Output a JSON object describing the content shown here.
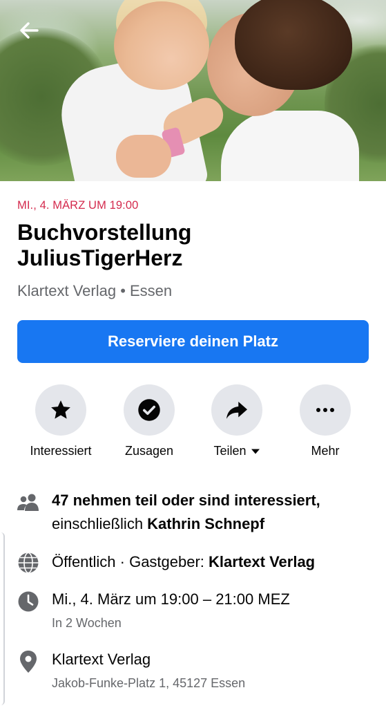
{
  "hero": {
    "image_alt": "Frau küsst Kind auf einer Wiese"
  },
  "event": {
    "date_line": "MI., 4. MÄRZ UM 19:00",
    "title_line1": "Buchvorstellung",
    "title_line2": "JuliusTigerHerz",
    "subtitle": "Klartext Verlag • Essen",
    "cta_label": "Reserviere deinen Platz"
  },
  "actions": [
    {
      "label": "Interessiert",
      "icon": "star-icon"
    },
    {
      "label": "Zusagen",
      "icon": "check-circle-icon"
    },
    {
      "label": "Teilen",
      "icon": "share-arrow-icon"
    },
    {
      "label": "Mehr",
      "icon": "more-dots-icon"
    }
  ],
  "details": {
    "attendance": {
      "count_text": "47 nehmen teil oder sind interessiert,",
      "including_prefix": "einschließlich ",
      "including_name": "Kathrin Schnepf",
      "icon": "people-icon"
    },
    "privacy": {
      "text": "Öffentlich · Gastgeber: ",
      "host": "Klartext Verlag",
      "icon": "globe-icon"
    },
    "time": {
      "text": "Mi., 4. März um 19:00 – 21:00 MEZ",
      "sub": "In 2 Wochen",
      "icon": "clock-icon"
    },
    "location": {
      "name": "Klartext Verlag",
      "address": "Jakob-Funke-Platz 1, 45127 Essen",
      "icon": "location-pin-icon"
    }
  },
  "colors": {
    "accent": "#1877f2",
    "date_red": "#d42a4d",
    "secondary_text": "#65676b",
    "icon_gray": "#65676b",
    "circle_bg": "#e4e6eb"
  }
}
